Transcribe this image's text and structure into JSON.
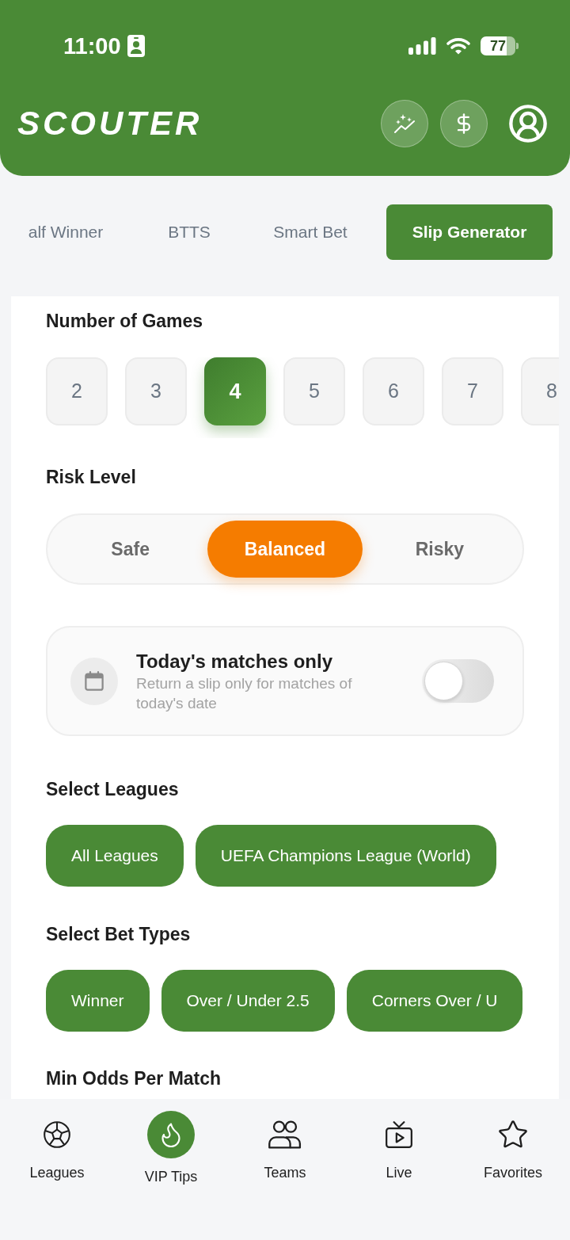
{
  "status_bar": {
    "time": "11:00",
    "battery": "77"
  },
  "header": {
    "logo": "SCOUTER"
  },
  "tabs": [
    {
      "label": "alf Winner",
      "selected": false
    },
    {
      "label": "BTTS",
      "selected": false
    },
    {
      "label": "Smart Bet",
      "selected": false
    },
    {
      "label": "Slip Generator",
      "selected": true
    }
  ],
  "games": {
    "title": "Number of Games",
    "options": [
      {
        "label": "2",
        "selected": false
      },
      {
        "label": "3",
        "selected": false
      },
      {
        "label": "4",
        "selected": true
      },
      {
        "label": "5",
        "selected": false
      },
      {
        "label": "6",
        "selected": false
      },
      {
        "label": "7",
        "selected": false
      },
      {
        "label": "8",
        "selected": false
      }
    ]
  },
  "risk": {
    "title": "Risk Level",
    "options": [
      {
        "label": "Safe",
        "selected": false
      },
      {
        "label": "Balanced",
        "selected": true
      },
      {
        "label": "Risky",
        "selected": false
      }
    ]
  },
  "today_filter": {
    "title": "Today's matches only",
    "description": "Return a slip only for matches of today's date",
    "on": false
  },
  "leagues": {
    "title": "Select Leagues",
    "chips": [
      {
        "label": "All Leagues",
        "selected": true
      },
      {
        "label": "UEFA Champions League (World)",
        "selected": true
      }
    ]
  },
  "bet_types": {
    "title": "Select Bet Types",
    "chips": [
      {
        "label": "Winner",
        "selected": true
      },
      {
        "label": "Over / Under 2.5",
        "selected": true
      },
      {
        "label": "Corners Over / U",
        "selected": true
      }
    ]
  },
  "min_odds": {
    "title": "Min Odds Per Match"
  },
  "bottom_nav": [
    {
      "label": "Leagues",
      "selected": false
    },
    {
      "label": "VIP Tips",
      "selected": true
    },
    {
      "label": "Teams",
      "selected": false
    },
    {
      "label": "Live",
      "selected": false
    },
    {
      "label": "Favorites",
      "selected": false
    }
  ]
}
